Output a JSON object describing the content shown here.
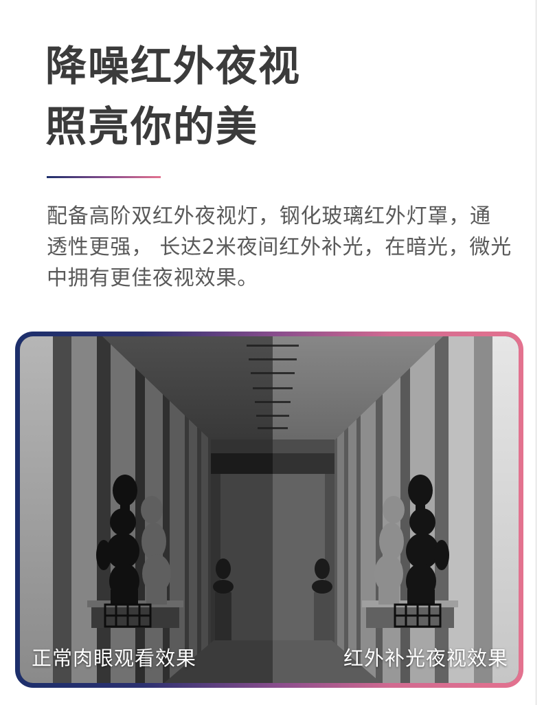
{
  "title": {
    "line1": "降噪红外夜视",
    "line2": "照亮你的美"
  },
  "description": {
    "lines": [
      "配备高阶双红外夜视灯，钢化玻璃红外灯罩，通",
      "透性更强， 长达2米夜间红外补光，在暗光，微光",
      "中拥有更佳夜视效果。"
    ]
  },
  "comparison": {
    "left_label": "正常肉眼观看效果",
    "right_label": "红外补光夜视效果"
  },
  "colors": {
    "title": "#3b3b3b",
    "body_text": "#595959",
    "accent_navy": "#1d2f6b",
    "accent_purple": "#8b4e8d",
    "accent_pink": "#e3728f",
    "label_text": "#ffffff"
  }
}
